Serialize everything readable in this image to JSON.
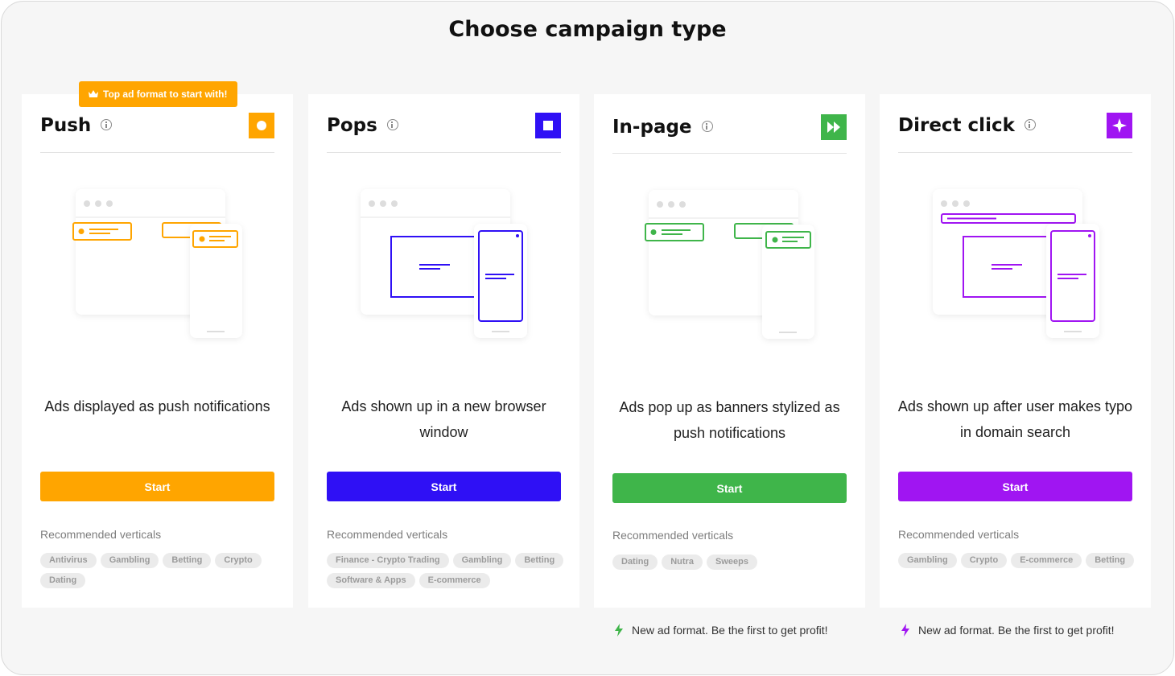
{
  "page": {
    "title": "Choose campaign type"
  },
  "badge": {
    "label": "Top ad format to start with!",
    "icon": "crown-icon"
  },
  "colors": {
    "push": "#ffa500",
    "pops": "#2f10f5",
    "inpage": "#3fb54a",
    "direct": "#a015f2"
  },
  "cards": [
    {
      "id": "push",
      "title": "Push",
      "icon": "circle-icon",
      "description": "Ads displayed as push notifications",
      "button": "Start",
      "recommended_label": "Recommended verticals",
      "tags": [
        "Antivirus",
        "Gambling",
        "Betting",
        "Crypto",
        "Dating"
      ]
    },
    {
      "id": "pops",
      "title": "Pops",
      "icon": "square-icon",
      "description": "Ads shown up in a new browser window",
      "button": "Start",
      "recommended_label": "Recommended verticals",
      "tags": [
        "Finance - Crypto Trading",
        "Gambling",
        "Betting",
        "Software & Apps",
        "E-commerce"
      ]
    },
    {
      "id": "inpage",
      "title": "In-page",
      "icon": "fast-forward-icon",
      "description": "Ads pop up as banners stylized as push notifications",
      "button": "Start",
      "recommended_label": "Recommended verticals",
      "tags": [
        "Dating",
        "Nutra",
        "Sweeps"
      ],
      "note": "New ad format. Be the first to get profit!"
    },
    {
      "id": "direct",
      "title": "Direct click",
      "icon": "sparkle-icon",
      "description": "Ads shown up after user makes typo in domain search",
      "button": "Start",
      "recommended_label": "Recommended verticals",
      "tags": [
        "Gambling",
        "Crypto",
        "E-commerce",
        "Betting"
      ],
      "note": "New ad format. Be the first to get profit!"
    }
  ]
}
